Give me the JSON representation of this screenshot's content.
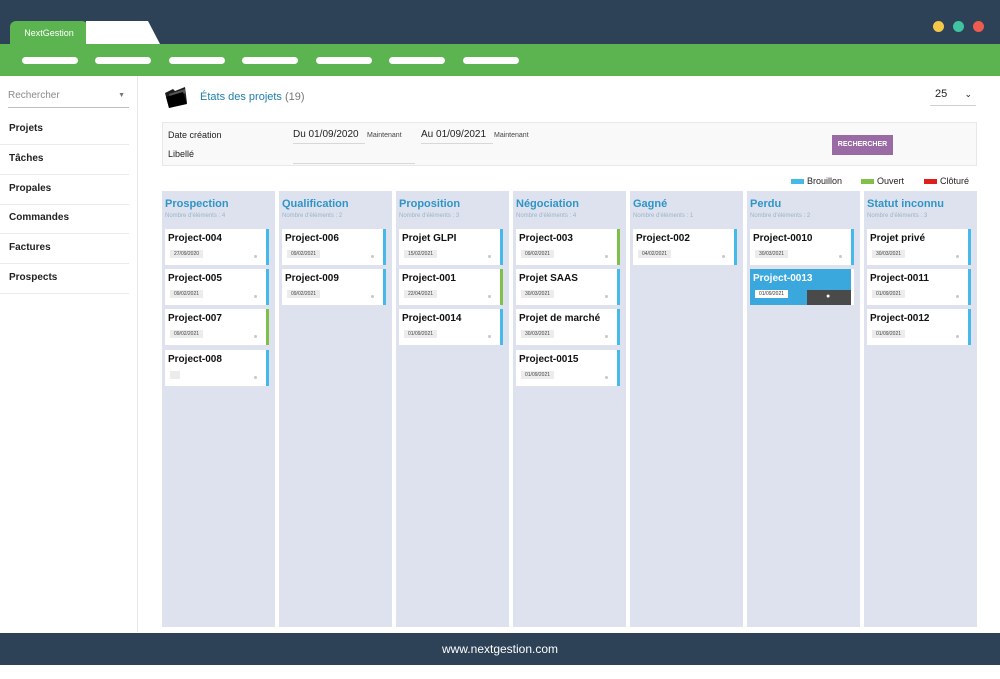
{
  "window": {
    "active_tab": "NextGestion",
    "dot_colors": [
      "#f4c94a",
      "#3fc3a1",
      "#ee5b4f"
    ]
  },
  "colors": {
    "titlebar": "#2d4157",
    "accent_green": "#5bb450",
    "column_bg": "#dde2ee",
    "title_blue": "#2f95c7",
    "button_purple": "#9a6aa5"
  },
  "sidebar": {
    "search_placeholder": "Rechercher",
    "items": [
      {
        "label": "Projets"
      },
      {
        "label": "Tâches"
      },
      {
        "label": "Propales"
      },
      {
        "label": "Commandes"
      },
      {
        "label": "Factures"
      },
      {
        "label": "Prospects"
      }
    ]
  },
  "header": {
    "title": "États des projets",
    "count": "(19)",
    "page_size": "25"
  },
  "filters": {
    "date_label": "Date création",
    "from_value": "Du 01/09/2020",
    "from_now": "Maintenant",
    "to_value": "Au 01/09/2021",
    "to_now": "Maintenant",
    "libelle_label": "Libellé",
    "search_button": "RECHERCHER"
  },
  "legend": [
    {
      "label": "Brouillon",
      "color": "#45b9e8"
    },
    {
      "label": "Ouvert",
      "color": "#7ec04a"
    },
    {
      "label": "Clôturé",
      "color": "#e01e1e"
    }
  ],
  "columns": [
    {
      "title": "Prospection",
      "subtitle": "Nombre d'éléments : 4",
      "cards": [
        {
          "title": "Project-004",
          "date": "27/09/2020",
          "status_color": "#45b9e8"
        },
        {
          "title": "Project-005",
          "date": "09/02/2021",
          "status_color": "#45b9e8"
        },
        {
          "title": "Project-007",
          "date": "09/02/2021",
          "status_color": "#7ec04a"
        },
        {
          "title": "Project-008",
          "date": "",
          "status_color": "#45b9e8"
        }
      ]
    },
    {
      "title": "Qualification",
      "subtitle": "Nombre d'éléments : 2",
      "cards": [
        {
          "title": "Project-006",
          "date": "09/02/2021",
          "status_color": "#45b9e8"
        },
        {
          "title": "Project-009",
          "date": "09/02/2021",
          "status_color": "#45b9e8"
        }
      ]
    },
    {
      "title": "Proposition",
      "subtitle": "Nombre d'éléments : 3",
      "cards": [
        {
          "title": "Projet GLPI",
          "date": "15/02/2021",
          "status_color": "#45b9e8"
        },
        {
          "title": "Project-001",
          "date": "22/04/2021",
          "status_color": "#7ec04a"
        },
        {
          "title": "Project-0014",
          "date": "01/09/2021",
          "status_color": "#45b9e8"
        }
      ]
    },
    {
      "title": "Négociation",
      "subtitle": "Nombre d'éléments : 4",
      "cards": [
        {
          "title": "Project-003",
          "date": "09/02/2021",
          "status_color": "#7ec04a"
        },
        {
          "title": "Projet SAAS",
          "date": "30/03/2021",
          "status_color": "#45b9e8"
        },
        {
          "title": "Projet de marché",
          "date": "30/03/2021",
          "status_color": "#45b9e8"
        },
        {
          "title": "Project-0015",
          "date": "01/09/2021",
          "status_color": "#45b9e8"
        }
      ]
    },
    {
      "title": "Gagné",
      "subtitle": "Nombre d'éléments : 1",
      "cards": [
        {
          "title": "Project-002",
          "date": "04/02/2021",
          "status_color": "#45b9e8"
        }
      ]
    },
    {
      "title": "Perdu",
      "subtitle": "Nombre d'éléments : 2",
      "cards": [
        {
          "title": "Project-0010",
          "date": "30/03/2021",
          "status_color": "#45b9e8"
        },
        {
          "title": "Project-0013",
          "date": "01/09/2021",
          "status_color": "#45b9e8",
          "selected": true
        }
      ]
    },
    {
      "title": "Statut inconnu",
      "subtitle": "Nombre d'éléments : 3",
      "cards": [
        {
          "title": "Projet privé",
          "date": "30/03/2021",
          "status_color": "#45b9e8"
        },
        {
          "title": "Project-0011",
          "date": "01/09/2021",
          "status_color": "#45b9e8"
        },
        {
          "title": "Project-0012",
          "date": "01/09/2021",
          "status_color": "#45b9e8"
        }
      ]
    }
  ],
  "footer": {
    "url": "www.nextgestion.com"
  }
}
